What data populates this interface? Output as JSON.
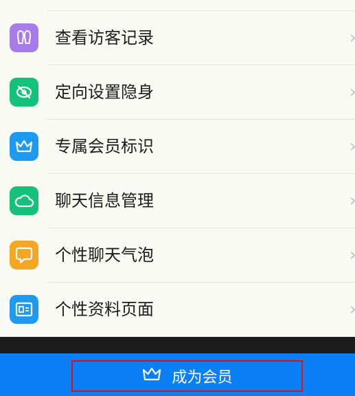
{
  "menu": {
    "items": [
      {
        "label": "查看访客记录",
        "icon": "footprints-icon",
        "color": "#a77be8"
      },
      {
        "label": "定向设置隐身",
        "icon": "eye-off-icon",
        "color": "#14c27c"
      },
      {
        "label": "专属会员标识",
        "icon": "crown-icon",
        "color": "#1e9af0"
      },
      {
        "label": "聊天信息管理",
        "icon": "cloud-icon",
        "color": "#14c27c"
      },
      {
        "label": "个性聊天气泡",
        "icon": "chat-bubble-icon",
        "color": "#f5a623"
      },
      {
        "label": "个性资料页面",
        "icon": "profile-card-icon",
        "color": "#1e9af0"
      }
    ],
    "chevron": "›"
  },
  "cta": {
    "label": "成为会员",
    "icon": "crown-icon",
    "color": "#0b7ff5"
  }
}
